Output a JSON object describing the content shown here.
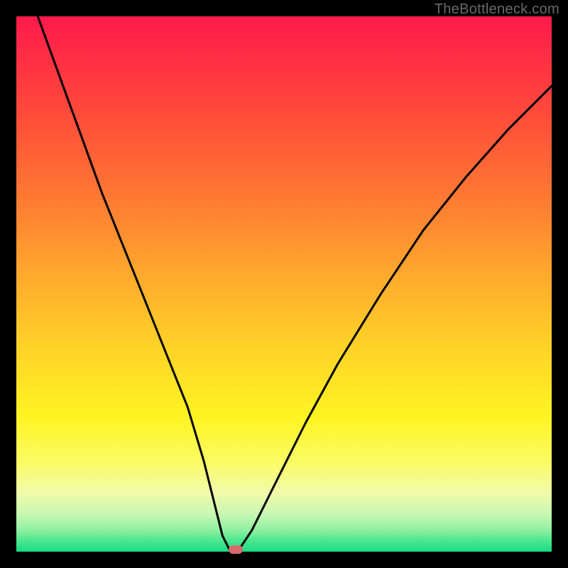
{
  "watermark": "TheBottleneck.com",
  "colors": {
    "page_bg": "#000000",
    "marker_fill": "#d76b6b",
    "curve_stroke": "#000000",
    "gradient_top": "#ff1a4b",
    "gradient_bottom": "#18dd85"
  },
  "chart_data": {
    "type": "line",
    "title": "",
    "xlabel": "",
    "ylabel": "",
    "xlim": [
      0,
      100
    ],
    "ylim": [
      0,
      100
    ],
    "grid": false,
    "series": [
      {
        "name": "bottleneck-curve",
        "x": [
          4,
          8,
          12,
          16,
          20,
          24,
          28,
          32,
          35,
          37,
          38.5,
          40,
          41,
          42,
          44,
          48,
          54,
          60,
          68,
          76,
          84,
          92,
          100
        ],
        "y": [
          100,
          89,
          78,
          67,
          57,
          47,
          37,
          27,
          17,
          9,
          3,
          0,
          0,
          1,
          4,
          12,
          24,
          35,
          48,
          60,
          70,
          79,
          87
        ]
      }
    ],
    "marker": {
      "x": 41,
      "y": 0.4,
      "shape": "rect",
      "color": "#d76b6b"
    },
    "notes": "Values are estimates read off the figure; axes have no ticks or labels so x/y are in percent of plot width/height measured from bottom-left."
  }
}
